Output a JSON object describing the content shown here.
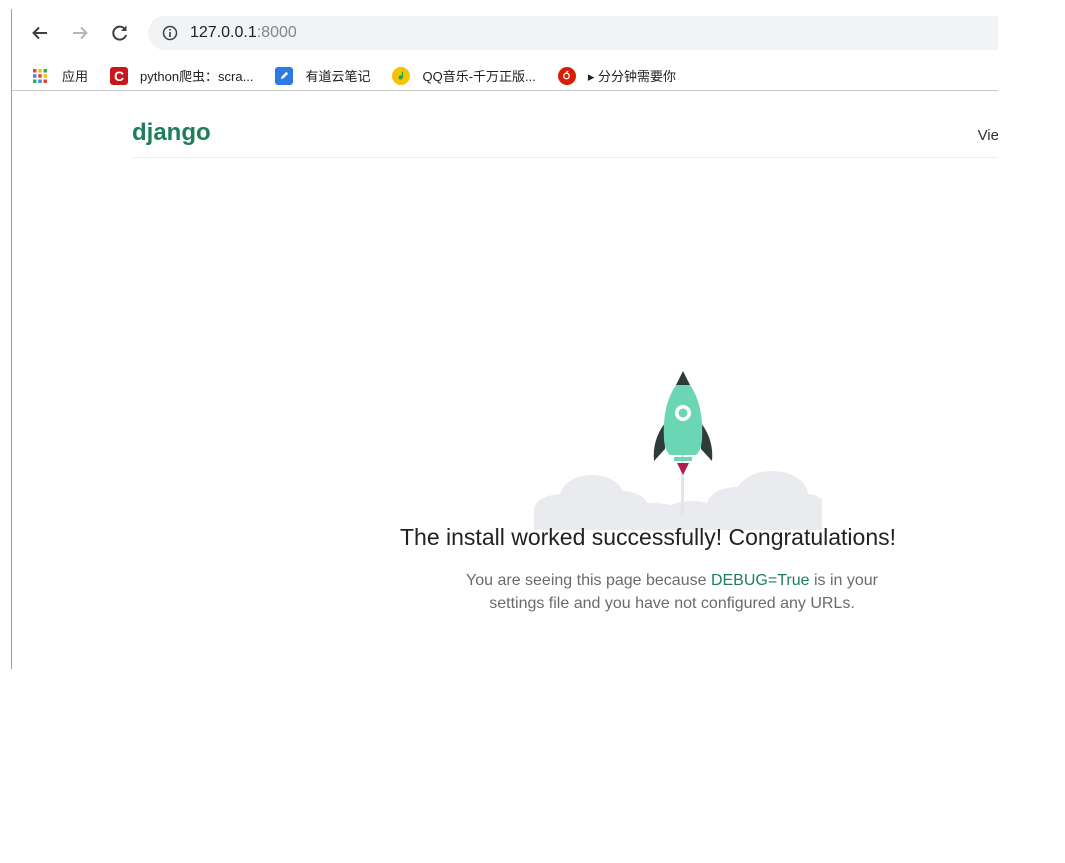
{
  "browser": {
    "url_host": "127.0.0.1",
    "url_port": ":8000",
    "bookmarks": [
      {
        "label": "应用",
        "icon": "apps-grid-icon"
      },
      {
        "label": "python爬虫：scra...",
        "icon": "csdn-icon",
        "color": "#c8161d"
      },
      {
        "label": "有道云笔记",
        "icon": "youdao-note-icon",
        "color": "#2c7be5"
      },
      {
        "label": "QQ音乐-千万正版...",
        "icon": "qq-music-icon",
        "color": "#f5c400"
      },
      {
        "label": "▸ 分分钟需要你",
        "icon": "netease-music-icon",
        "color": "#d81e06"
      }
    ]
  },
  "page": {
    "logo": "django",
    "release_link": "Vie",
    "headline": "The install worked successfully! Congratulations!",
    "subtext_before": "You are seeing this page because ",
    "subtext_code": "DEBUG=True",
    "subtext_after": " is in your settings file and you have not configured any URLs."
  },
  "colors": {
    "accent": "#1e7e5a",
    "rocket_body": "#6bd6b4",
    "cloud": "#e9ebee"
  }
}
